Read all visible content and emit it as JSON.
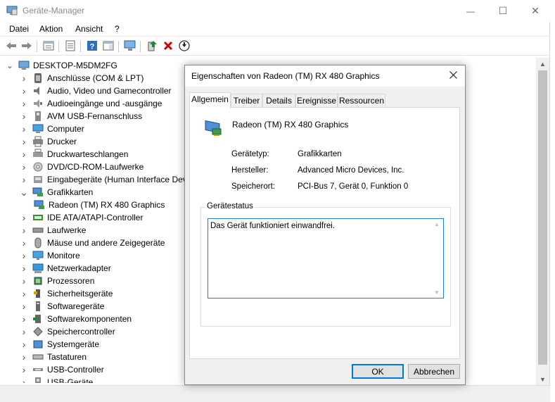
{
  "window": {
    "title": "Geräte-Manager",
    "controls": {
      "minimize": "—",
      "maximize": "☐",
      "close": "✕"
    }
  },
  "menu": [
    "Datei",
    "Aktion",
    "Ansicht",
    "?"
  ],
  "toolbar": {
    "buttons": [
      "back-icon",
      "forward-icon",
      "properties-view-icon",
      "details-icon",
      "help-icon",
      "action-pane-icon",
      "monitor-icon",
      "update-driver-icon",
      "uninstall-icon",
      "disable-device-icon"
    ],
    "colors": {
      "uninstall": "#d40000",
      "update": "#1b8a2e"
    }
  },
  "tree": {
    "root": "DESKTOP-M5DM2FG",
    "items": [
      {
        "label": "Anschlüsse (COM & LPT)",
        "icon": "port-icon",
        "expanded": false
      },
      {
        "label": "Audio, Video und Gamecontroller",
        "icon": "speaker-icon",
        "expanded": false
      },
      {
        "label": "Audioeingänge und -ausgänge",
        "icon": "audio-io-icon",
        "expanded": false
      },
      {
        "label": "AVM USB-Fernanschluss",
        "icon": "usb-device-icon",
        "expanded": false
      },
      {
        "label": "Computer",
        "icon": "computer-icon",
        "expanded": false
      },
      {
        "label": "Drucker",
        "icon": "printer-icon",
        "expanded": false
      },
      {
        "label": "Druckwarteschlangen",
        "icon": "print-queue-icon",
        "expanded": false
      },
      {
        "label": "DVD/CD-ROM-Laufwerke",
        "icon": "dvd-drive-icon",
        "expanded": false
      },
      {
        "label": "Eingabegeräte (Human Interface Devi",
        "icon": "hid-icon",
        "expanded": false
      },
      {
        "label": "Grafikkarten",
        "icon": "display-adapter-icon",
        "expanded": true
      },
      {
        "label": "Radeon (TM) RX 480 Graphics",
        "icon": "gpu-icon",
        "child": true
      },
      {
        "label": "IDE ATA/ATAPI-Controller",
        "icon": "ide-controller-icon",
        "expanded": false
      },
      {
        "label": "Laufwerke",
        "icon": "disk-drive-icon",
        "expanded": false
      },
      {
        "label": "Mäuse und andere Zeigegeräte",
        "icon": "mouse-icon",
        "expanded": false
      },
      {
        "label": "Monitore",
        "icon": "monitor-icon",
        "expanded": false
      },
      {
        "label": "Netzwerkadapter",
        "icon": "network-adapter-icon",
        "expanded": false
      },
      {
        "label": "Prozessoren",
        "icon": "processor-icon",
        "expanded": false
      },
      {
        "label": "Sicherheitsgeräte",
        "icon": "security-device-icon",
        "expanded": false
      },
      {
        "label": "Softwaregeräte",
        "icon": "software-device-icon",
        "expanded": false
      },
      {
        "label": "Softwarekomponenten",
        "icon": "software-component-icon",
        "expanded": false
      },
      {
        "label": "Speichercontroller",
        "icon": "storage-controller-icon",
        "expanded": false
      },
      {
        "label": "Systemgeräte",
        "icon": "system-device-icon",
        "expanded": false
      },
      {
        "label": "Tastaturen",
        "icon": "keyboard-icon",
        "expanded": false
      },
      {
        "label": "USB-Controller",
        "icon": "usb-controller-icon",
        "expanded": false
      },
      {
        "label": "USB-Geräte",
        "icon": "usb-device-icon",
        "expanded": false
      }
    ]
  },
  "dialog": {
    "title": "Eigenschaften von Radeon (TM) RX 480 Graphics",
    "tabs": [
      "Allgemein",
      "Treiber",
      "Details",
      "Ereignisse",
      "Ressourcen"
    ],
    "active_tab": "Allgemein",
    "device_name": "Radeon (TM) RX 480 Graphics",
    "properties": [
      {
        "label": "Gerätetyp:",
        "value": "Grafikkarten"
      },
      {
        "label": "Hersteller:",
        "value": "Advanced Micro Devices, Inc."
      },
      {
        "label": "Speicherort:",
        "value": "PCI-Bus 7, Gerät 0, Funktion 0"
      }
    ],
    "status_group_label": "Gerätestatus",
    "status_text": "Das Gerät funktioniert einwandfrei.",
    "ok_label": "OK",
    "cancel_label": "Abbrechen"
  }
}
